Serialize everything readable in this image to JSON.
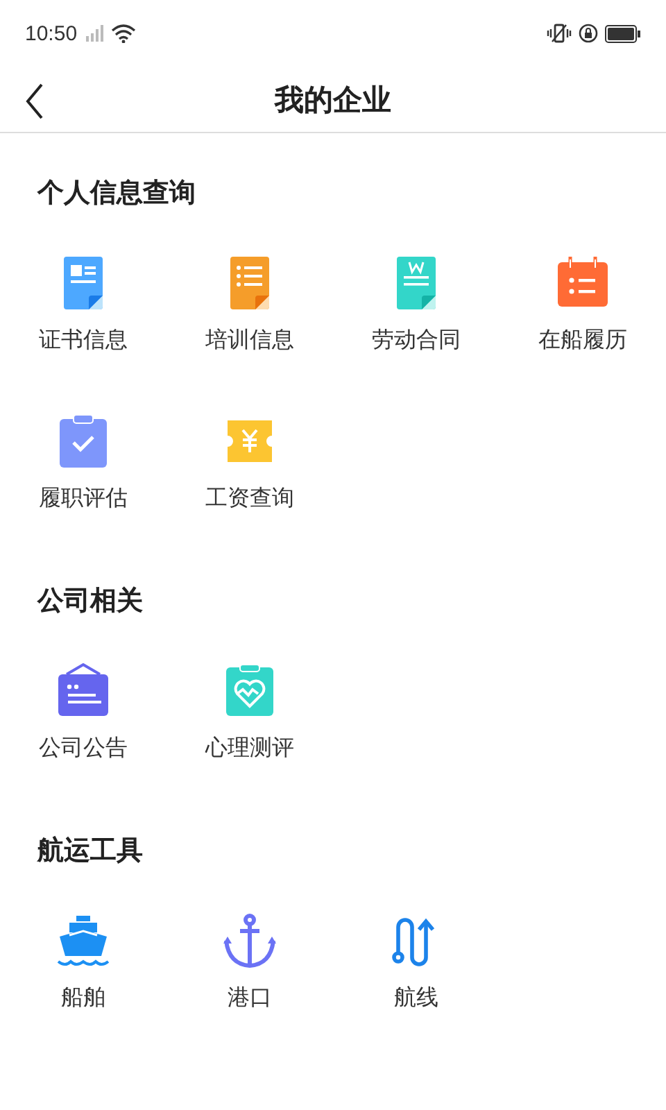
{
  "status_bar": {
    "time": "10:50"
  },
  "header": {
    "title": "我的企业"
  },
  "sections": [
    {
      "title": "个人信息查询",
      "items": [
        {
          "label": "证书信息"
        },
        {
          "label": "培训信息"
        },
        {
          "label": "劳动合同"
        },
        {
          "label": "在船履历"
        },
        {
          "label": "履职评估"
        },
        {
          "label": "工资查询"
        }
      ]
    },
    {
      "title": "公司相关",
      "items": [
        {
          "label": "公司公告"
        },
        {
          "label": "心理测评"
        }
      ]
    },
    {
      "title": "航运工具",
      "items": [
        {
          "label": "船舶"
        },
        {
          "label": "港口"
        },
        {
          "label": "航线"
        }
      ]
    }
  ]
}
